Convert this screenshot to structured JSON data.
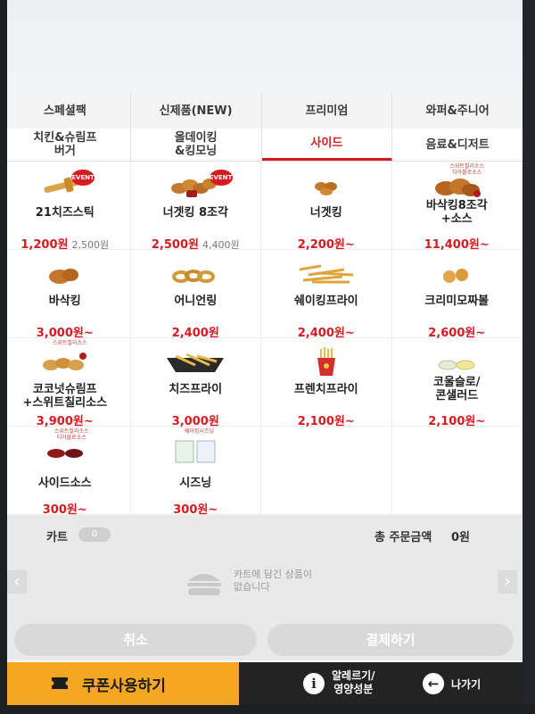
{
  "categories": {
    "row1": [
      "스페셜팩",
      "신제품(NEW)",
      "프리미엄",
      "와퍼&주니어"
    ],
    "row2": [
      "치킨&슈림프\n버거",
      "올데이킹\n&킹모닝",
      "사이드",
      "음료&디저트"
    ],
    "active": "사이드"
  },
  "products": [
    {
      "name": "21치즈스틱",
      "price": "1,200원",
      "original_price": "2,500원",
      "badge": "EVENT",
      "icon": "cheese-stick"
    },
    {
      "name": "너겟킹 8조각",
      "price": "2,500원",
      "original_price": "4,400원",
      "badge": "EVENT",
      "icon": "nugget"
    },
    {
      "name": "너겟킹",
      "price": "2,200원~",
      "icon": "nugget-small"
    },
    {
      "name": "바삭킹8조각\n+소스",
      "price": "11,400원~",
      "icon": "chicken-wings",
      "mini_label": "스위트칠리소스\n디아블로소스"
    },
    {
      "name": "바삭킹",
      "price": "3,000원~",
      "icon": "chicken-wing"
    },
    {
      "name": "어니언링",
      "price": "2,400원",
      "icon": "onion-ring"
    },
    {
      "name": "쉐이킹프라이",
      "price": "2,400원~",
      "icon": "shaking-fries"
    },
    {
      "name": "크리미모짜볼",
      "price": "2,600원~",
      "icon": "mozza-ball"
    },
    {
      "name": "코코넛슈림프\n+스위트칠리소스",
      "price": "3,900원~",
      "icon": "coconut-shrimp",
      "mini_label": "스위트칠리소스"
    },
    {
      "name": "치즈프라이",
      "price": "3,000원",
      "icon": "cheese-fries"
    },
    {
      "name": "프렌치프라이",
      "price": "2,100원~",
      "icon": "french-fries"
    },
    {
      "name": "코울슬로/\n콘샐러드",
      "price": "2,100원~",
      "icon": "coleslaw"
    },
    {
      "name": "사이드소스",
      "price": "300원~",
      "icon": "sauce-cups",
      "mini_label": "스위트칠리소스\n디아블로소스"
    },
    {
      "name": "시즈닝",
      "price": "300원~",
      "icon": "seasoning-packets",
      "mini_label": "쉐이킹시즈닝"
    }
  ],
  "cart": {
    "label": "카트",
    "count": "0",
    "total_label": "총 주문금액",
    "total_value": "0원",
    "empty_message": "카트에 담긴 상품이\n없습니다",
    "cancel_label": "취소",
    "pay_label": "결제하기"
  },
  "bottom": {
    "coupon_label": "쿠폰사용하기",
    "info_label": "알레르기/\n영양성분",
    "exit_label": "나가기"
  },
  "colors": {
    "accent": "#d71920",
    "coupon": "#f5a623",
    "bar": "#232323"
  }
}
